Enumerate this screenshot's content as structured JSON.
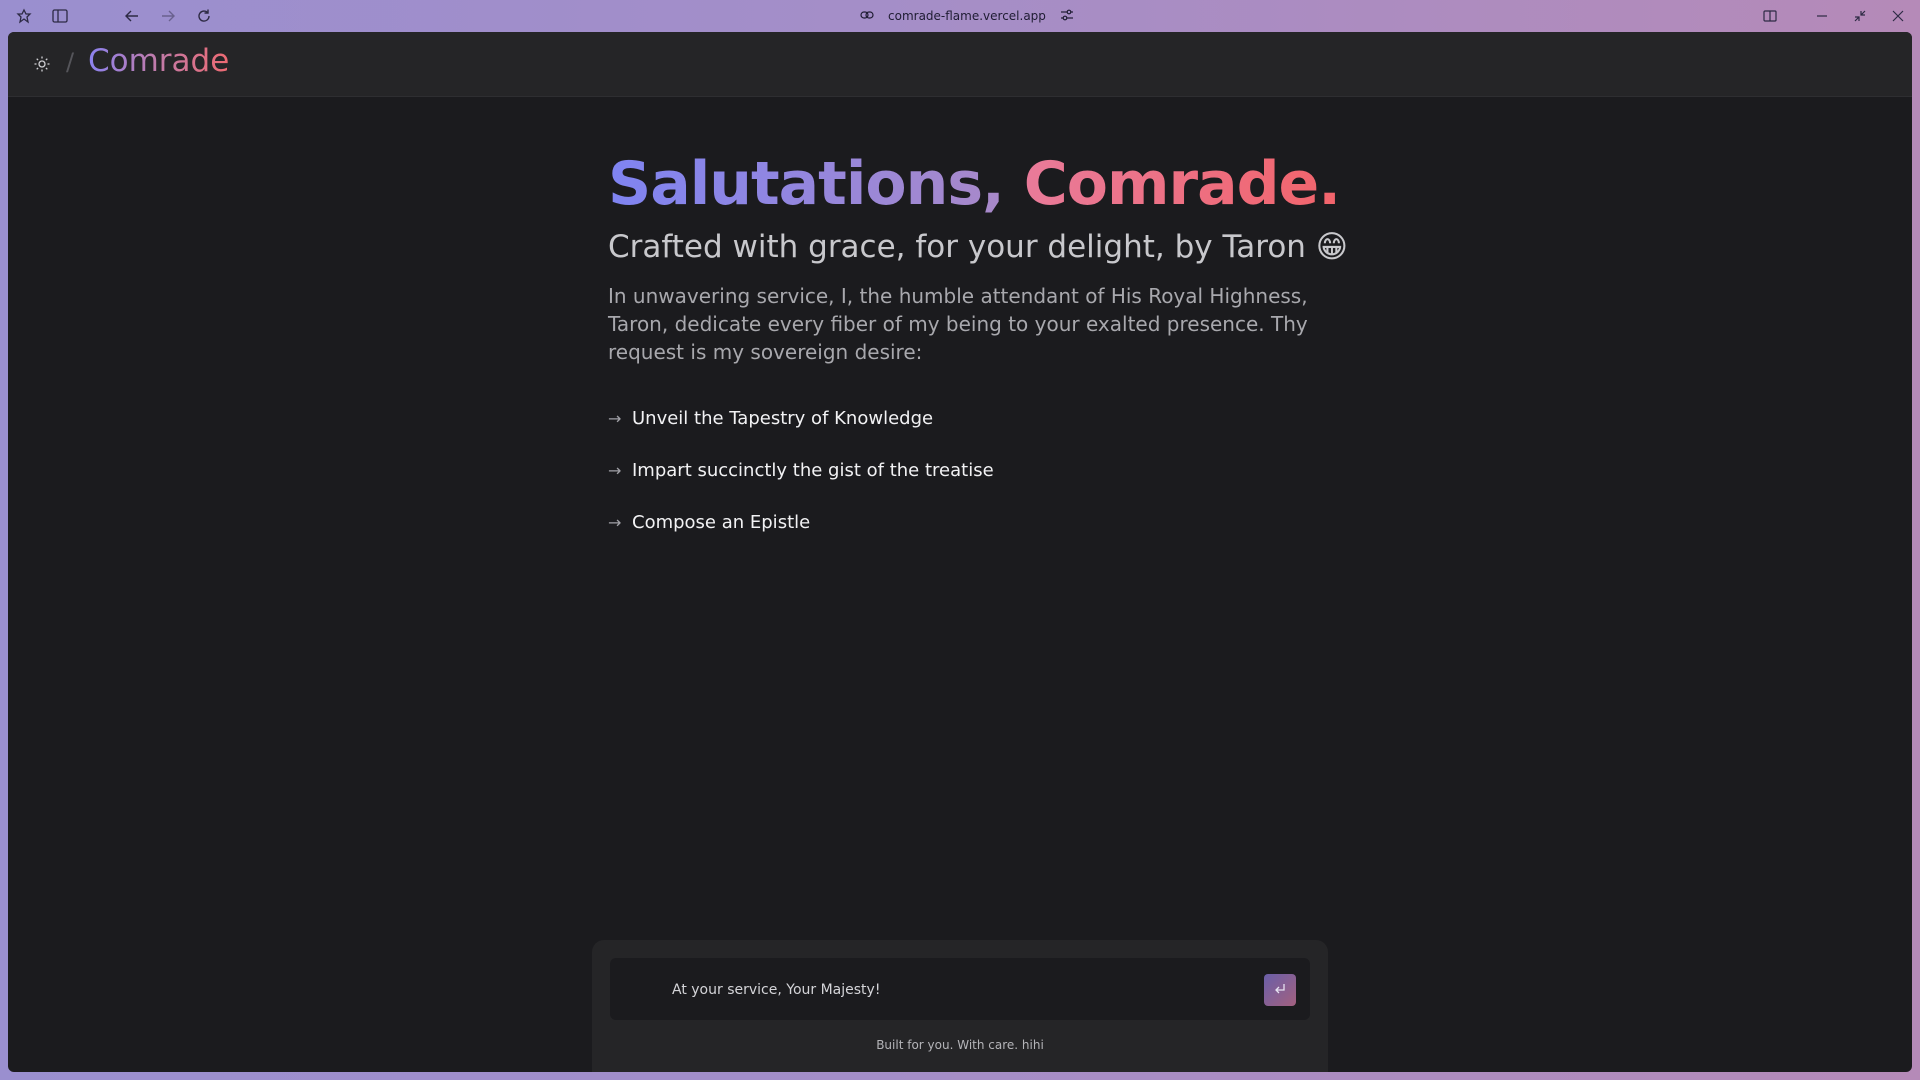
{
  "browser": {
    "url": "comrade-flame.vercel.app"
  },
  "header": {
    "brand": "Comrade"
  },
  "hero": {
    "greeting_part1": "Salutations,",
    "greeting_part2": "Comrade.",
    "subtitle": "Crafted with grace, for your delight, by Taron 😁",
    "description": "In unwavering service, I, the humble attendant of His Royal Highness, Taron, dedicate every fiber of my being to your exalted presence. Thy request is my sovereign desire:"
  },
  "suggestions": [
    {
      "label": "Unveil the Tapestry of Knowledge"
    },
    {
      "label": "Impart succinctly the gist of the treatise"
    },
    {
      "label": "Compose an Epistle"
    }
  ],
  "composer": {
    "placeholder": "At your service, Your Majesty!",
    "footer": "Built for you. With care. hihi"
  },
  "colors": {
    "brand_start": "#8b82f0",
    "brand_end": "#ee6a72",
    "window_bg": "#1b1b1e"
  }
}
